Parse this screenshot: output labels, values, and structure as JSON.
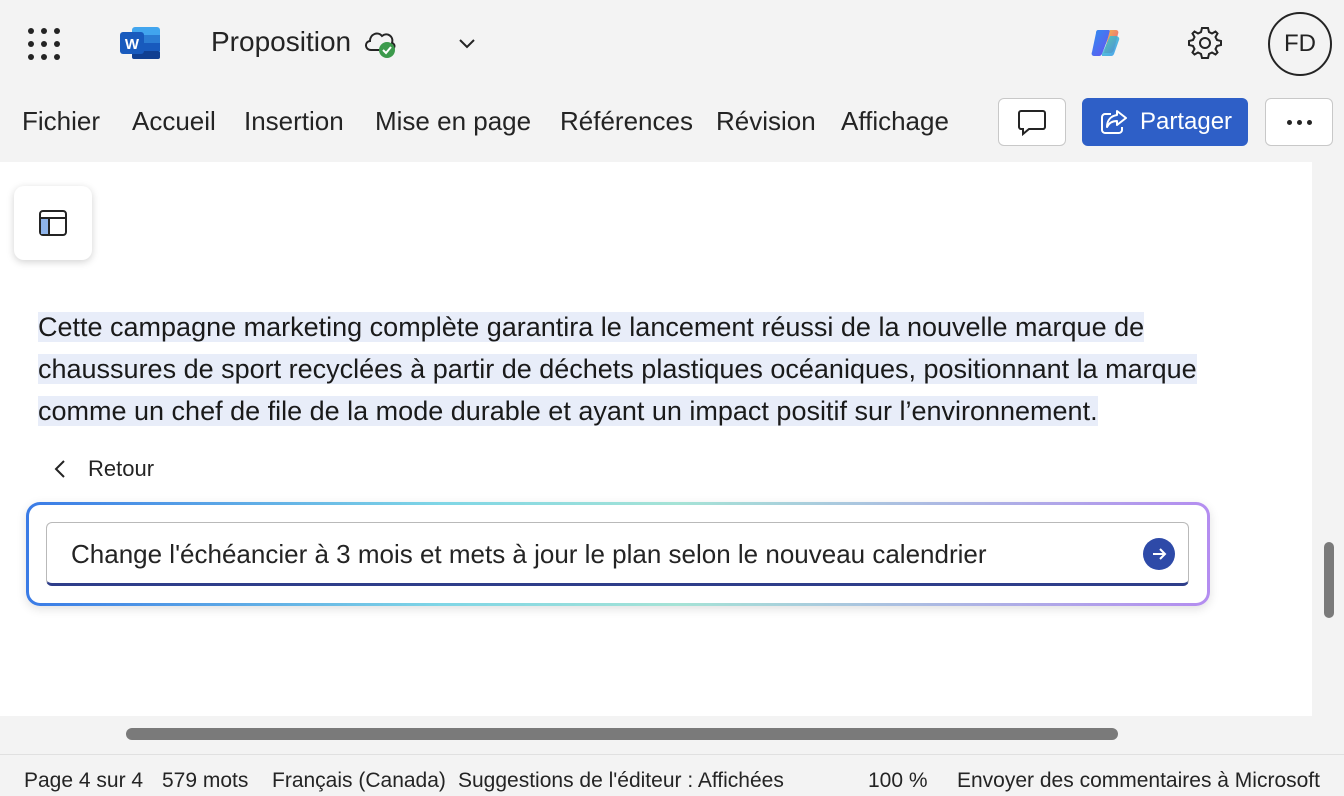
{
  "header": {
    "doc_title": "Proposition",
    "app_logo_letter": "W",
    "avatar_initials": "FD"
  },
  "menu": {
    "items": [
      "Fichier",
      "Accueil",
      "Insertion",
      "Mise en page",
      "Références",
      "Révision",
      "Affichage"
    ],
    "share_label": "Partager"
  },
  "document": {
    "paragraph_lines": [
      "Cette campagne marketing complète garantira le lancement réussi de la nouvelle marque de",
      "chaussures de sport recyclées à partir de déchets plastiques océaniques, positionnant la marque",
      "comme un chef de file de la mode durable et ayant un impact positif sur l’environnement."
    ]
  },
  "copilot": {
    "back_label": "Retour",
    "prompt_value": "Change l'échéancier à 3 mois et mets à jour le plan selon le nouveau calendrier"
  },
  "status": {
    "page": "Page 4 sur 4",
    "words": "579 mots",
    "language": "Français (Canada)",
    "editor": "Suggestions de l'éditeur : Affichées",
    "zoom": "100 %",
    "feedback": "Envoyer des commentaires à Microsoft"
  },
  "colors": {
    "accent": "#2e5fc7",
    "selection": "#e8edf9",
    "cloud_check": "#3c9a4c"
  },
  "icons": [
    "app-launcher-icon",
    "word-logo-icon",
    "cloud-saved-icon",
    "chevron-down-icon",
    "copilot-icon",
    "gear-icon",
    "comment-icon",
    "share-icon",
    "more-icon",
    "navigation-pane-icon",
    "chevron-left-icon",
    "send-arrow-icon"
  ]
}
